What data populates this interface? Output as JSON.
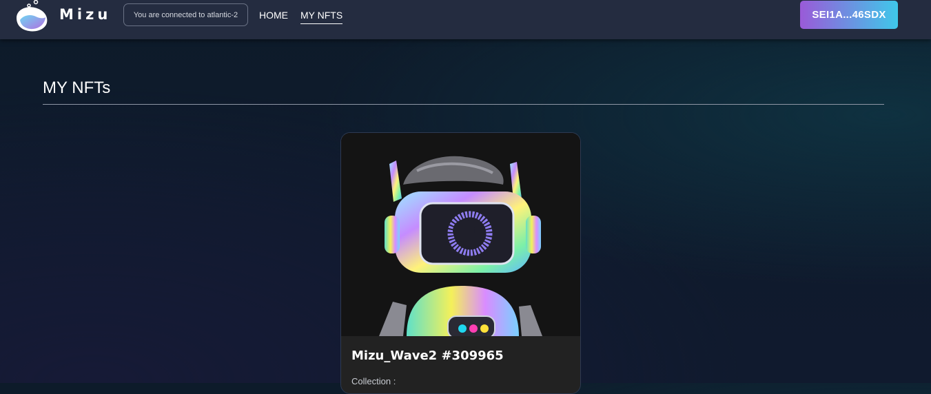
{
  "brand": {
    "name": "Mizu"
  },
  "header": {
    "network_status": "You are connected to atlantic-2",
    "nav": [
      {
        "label": "HOME",
        "active": false
      },
      {
        "label": "MY NFTS",
        "active": true
      }
    ],
    "wallet_label": "SEI1A...46SDX"
  },
  "main": {
    "title": "MY NFTs",
    "nfts": [
      {
        "name": "Mizu_Wave2 #309965",
        "collection_label": "Collection :"
      }
    ]
  },
  "colors": {
    "navbar": "#242c40",
    "wallet_gradient_start": "#9a5ad8",
    "wallet_gradient_end": "#3fc8ea",
    "card": "#222222"
  },
  "icons": {
    "logo": "mizu-wave-logo-icon"
  }
}
